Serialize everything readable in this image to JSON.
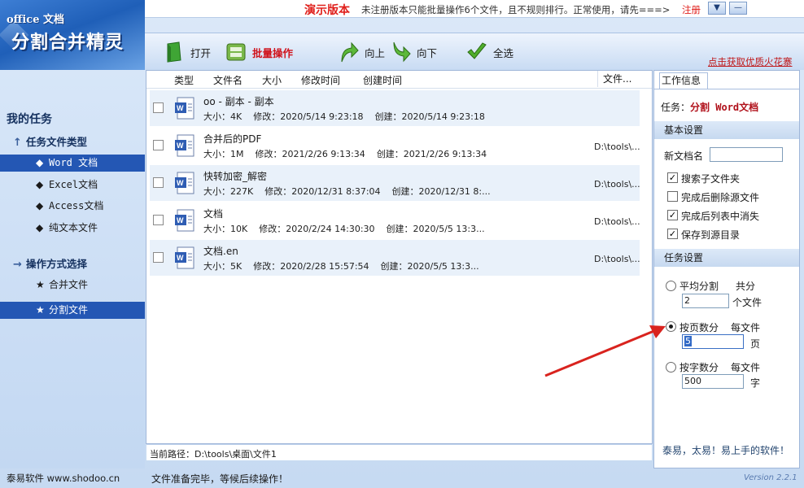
{
  "logo": {
    "line1": "office 文档",
    "line2": "分割合并精灵"
  },
  "topbar": {
    "demo_title": "演示版本",
    "demo_message": "未注册版本只能批量操作6个文件，且不规则排行。正常使用，请先===>",
    "register_label": "注册",
    "minimize_symbol": "▼",
    "close_symbol": "—"
  },
  "toolbar": {
    "open_label": "打开",
    "batch_label": "批量操作",
    "up_label": "向上",
    "down_label": "向下",
    "select_all_label": "全选",
    "promo_link": "点击获取优质火花寨",
    "colors": {
      "batch_label": "#d0121b",
      "promo_link": "#c0181a"
    }
  },
  "sidebar": {
    "my_tasks": "我的任务",
    "group1": {
      "label": "任务文件类型",
      "icon": "arrow-up-icon"
    },
    "file_types": [
      {
        "label": "Word 文档",
        "selected": true
      },
      {
        "label": "Excel文档",
        "selected": false
      },
      {
        "label": "Access文档",
        "selected": false
      },
      {
        "label": "纯文本文件",
        "selected": false
      }
    ],
    "group2": {
      "label": "操作方式选择",
      "icon": "arrow-right-icon"
    },
    "operations": [
      {
        "label": "合并文件",
        "selected": false
      },
      {
        "label": "分割文件",
        "selected": true
      }
    ],
    "brand": "泰易软件 www.shodoo.cn",
    "colors": {
      "selected_bg": "#2457b4"
    }
  },
  "file_list": {
    "headers": {
      "type": "类型",
      "name": "文件名",
      "size": "大小",
      "modified": "修改时间",
      "created": "创建时间",
      "path": "文件..."
    },
    "rows": [
      {
        "name": "oo - 副本 - 副本",
        "size": "大小：4K",
        "modified": "修改：2020/5/14 9:23:18",
        "created": "创建：2020/5/14 9:23:18",
        "path": ""
      },
      {
        "name": "合并后的PDF",
        "size": "大小：1M",
        "modified": "修改：2021/2/26 9:13:34",
        "created": "创建：2021/2/26 9:13:34",
        "path": "D:\\tools\\..."
      },
      {
        "name": "快转加密_解密",
        "size": "大小：227K",
        "modified": "修改：2020/12/31 8:37:04",
        "created": "创建：2020/12/31 8:...",
        "path": "D:\\tools\\..."
      },
      {
        "name": "文档",
        "size": "大小：10K",
        "modified": "修改：2020/2/24 14:30:30",
        "created": "创建：2020/5/5 13:3...",
        "path": "D:\\tools\\..."
      },
      {
        "name": "文档.en",
        "size": "大小：5K",
        "modified": "修改：2020/2/28 15:57:54",
        "created": "创建：2020/5/5 13:3...",
        "path": "D:\\tools\\..."
      }
    ],
    "current_path": "当前路径：D:\\tools\\桌面\\文件1"
  },
  "status": {
    "message": "文件准备完毕，等候后续操作！"
  },
  "right_panel": {
    "tab_label": "工作信息",
    "task_prefix": "任务：",
    "task_value": "分割 Word文档",
    "basic_section": "基本设置",
    "new_doc_name_label": "新文档名",
    "new_doc_name_value": "",
    "options": [
      {
        "label": "搜索子文件夹",
        "checked": true
      },
      {
        "label": "完成后删除源文件",
        "checked": false
      },
      {
        "label": "完成后列表中消失",
        "checked": true
      },
      {
        "label": "保存到源目录",
        "checked": true
      }
    ],
    "task_section": "任务设置",
    "split_modes": [
      {
        "label": "平均分割",
        "unit_prefix": "共分",
        "value": "2",
        "unit_suffix": "个文件",
        "selected": false
      },
      {
        "label": "按页数分",
        "unit_prefix": "每文件",
        "value": "5",
        "unit_suffix": "页",
        "selected": true
      },
      {
        "label": "按字数分",
        "unit_prefix": "每文件",
        "value": "500",
        "unit_suffix": "字",
        "selected": false
      }
    ],
    "motto": "泰易，太易！易上手的软件！",
    "colors": {
      "task_value": "#b0101a"
    }
  },
  "version": "Version 2.2.1"
}
